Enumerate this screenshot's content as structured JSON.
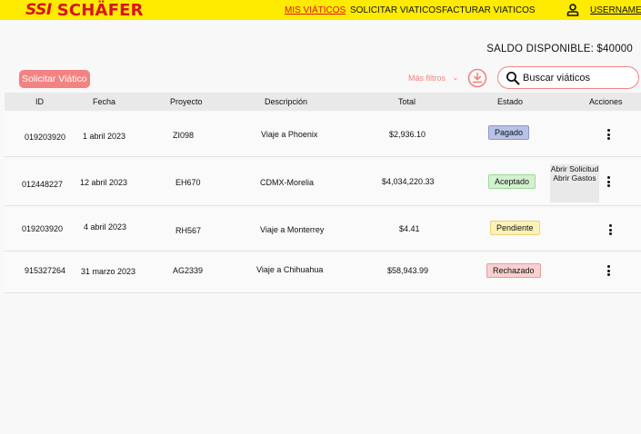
{
  "brand": {
    "mark": "SSI",
    "name": "SCHÄFER"
  },
  "nav": {
    "mis_viaticos": "MIS VIÁTICOS",
    "solicitar": "SOLICITAR VIATICOS",
    "facturar": "FACTURAR VIATICOS",
    "username": "USERNAME"
  },
  "saldo": "SALDO DISPONIBLE: $40000",
  "toolbar": {
    "solicitar_label": "Solicitar Viático",
    "mas_filtros": "Más filtros",
    "search_placeholder": "Buscar viáticos"
  },
  "table": {
    "headers": {
      "id": "ID",
      "fecha": "Fecha",
      "proyecto": "Proyecto",
      "descripcion": "Descripción",
      "total": "Total",
      "estado": "Estado",
      "acciones": "Acciones"
    },
    "rows": [
      {
        "id": "019203920",
        "fecha": "1 abril 2023",
        "proyecto": "ZI098",
        "descripcion": "Viaje  a Phoenix",
        "total": "$2,936.10",
        "estado": "Pagado"
      },
      {
        "id": "012448227",
        "fecha": "12 abril 2023",
        "proyecto": "EH670",
        "descripcion": "CDMX-Morelia",
        "total": "$4,034,220.33",
        "estado": "Aceptado"
      },
      {
        "id": "019203920",
        "fecha": "4 abril 2023",
        "proyecto": "RH567",
        "descripcion": "Viaje a Monterrey",
        "total": "$4.41",
        "estado": "Pendiente"
      },
      {
        "id": "915327264",
        "fecha": "31 marzo 2023",
        "proyecto": "AG2339",
        "descripcion": "Viaje a Chihuahua",
        "total": "$58,943.99",
        "estado": "Rechazado"
      }
    ]
  },
  "actions_menu": {
    "abrir_solicitud": "Abrir Solicitud",
    "abrir_gastos": "Abrir Gastos"
  },
  "colors": {
    "brand_red": "#d8141d",
    "brand_yellow": "#ffeb00",
    "accent_pink": "#f38282"
  }
}
